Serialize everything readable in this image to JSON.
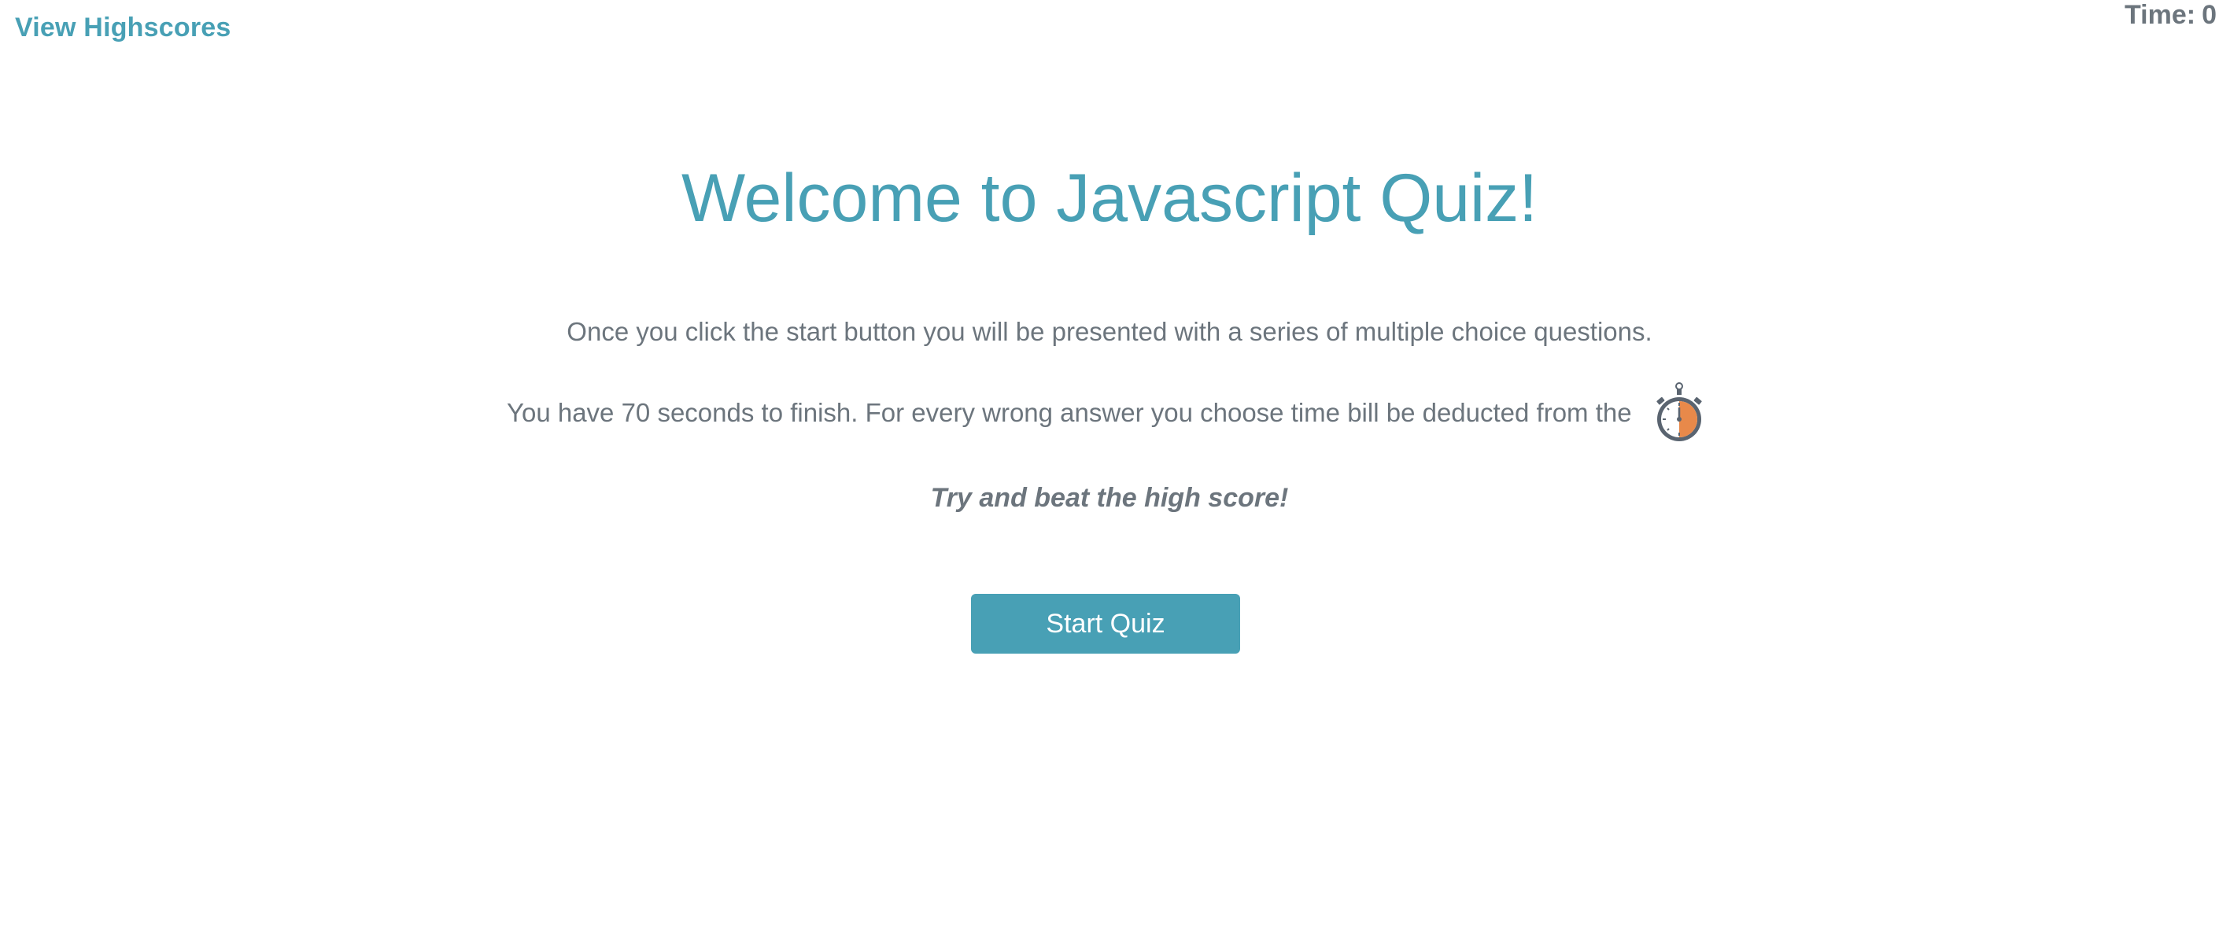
{
  "header": {
    "view_highscores_label": "View Highscores",
    "timer_label": "Time:",
    "timer_value": "0"
  },
  "main": {
    "title": "Welcome to Javascript Quiz!",
    "intro": "Once you click the start button you will be presented with a series of multiple choice questions.",
    "rules": "You have 70 seconds to finish. For every wrong answer you choose time bill be deducted from the",
    "rules_icon": "stopwatch-icon",
    "tagline": "Try and beat the high score!",
    "start_label": "Start Quiz"
  },
  "colors": {
    "accent": "#48a0b5",
    "text": "#6c757d",
    "stopwatch_fill": "#e8894a",
    "stopwatch_body": "#5a6470"
  }
}
